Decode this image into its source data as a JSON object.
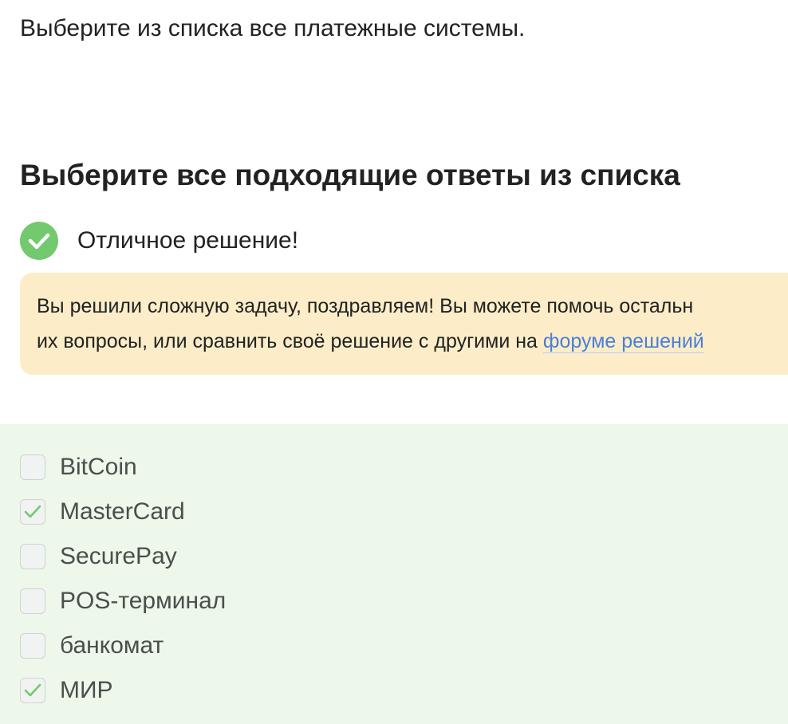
{
  "question": "Выберите из списка все платежные системы.",
  "heading": "Выберите все подходящие ответы из списка",
  "result": {
    "icon": "check-circle-icon",
    "text": "Отличное решение!"
  },
  "notice": {
    "line1": "Вы решили сложную задачу, поздравляем! Вы можете помочь остальн",
    "line2_prefix": "их вопросы, или сравнить своё решение с другими на ",
    "link": "форуме решений"
  },
  "options": [
    {
      "label": "BitCoin",
      "checked": false
    },
    {
      "label": "MasterCard",
      "checked": true
    },
    {
      "label": "SecurePay",
      "checked": false
    },
    {
      "label": "POS-терминал",
      "checked": false
    },
    {
      "label": "банкомат",
      "checked": false
    },
    {
      "label": "МИР",
      "checked": true
    }
  ],
  "colors": {
    "success": "#73c96e",
    "notice_bg": "#fcedc8",
    "options_bg": "#edf7ea",
    "link": "#4a7fd8"
  }
}
